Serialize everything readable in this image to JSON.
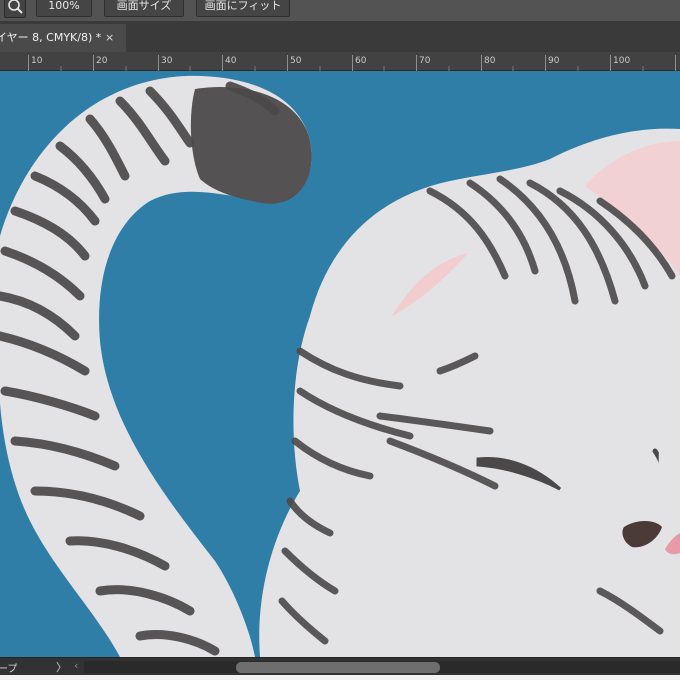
{
  "options_bar": {
    "zoom_tool_icon": "zoom-magnifier-icon",
    "zoom_value": "100%",
    "fit_screen_button": "画面サイズ",
    "fit_window_button": "画面にフィット"
  },
  "document_tab": {
    "title": "イヤー 8, CMYK/8) *",
    "close": "×"
  },
  "ruler": {
    "labels": [
      "10",
      "20",
      "30",
      "40",
      "50",
      "60",
      "70",
      "80",
      "90",
      "100"
    ]
  },
  "status_bar": {
    "text": "ープ",
    "arrow_right": "〉",
    "arrow_left": "‹"
  },
  "colors": {
    "canvas_background": "#2f7ea8",
    "cat_fur": "#e3e2e4",
    "stripes": "#4a4848",
    "tail_tip": "#555353",
    "ear_inner": "#f4d2d4",
    "nose": "#4a3b38",
    "tongue": "#e89aa7"
  }
}
